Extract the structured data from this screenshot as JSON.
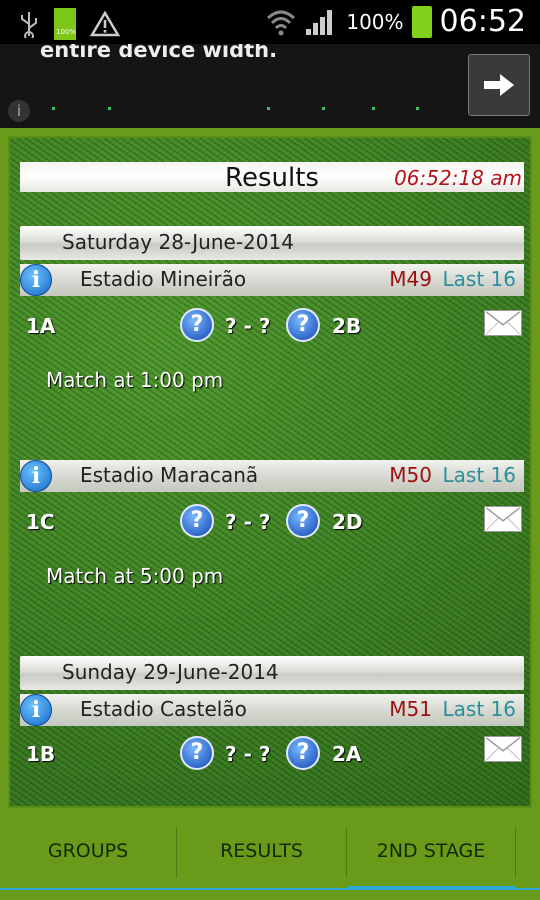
{
  "status_bar": {
    "battery_small_label": "100%",
    "battery_percent": "100%",
    "time": "06:52",
    "icons": [
      "usb-icon",
      "battery-icon",
      "warning-icon",
      "wifi-icon",
      "signal-icon",
      "battery-icon"
    ]
  },
  "ad": {
    "text": "entire device width.",
    "info_glyph": "i",
    "arrow_glyph": "→"
  },
  "header": {
    "title": "Results",
    "clock": "06:52:18 am"
  },
  "days": [
    {
      "label": "Saturday 28-June-2014"
    },
    {
      "label": "Sunday 29-June-2014"
    }
  ],
  "matches": [
    {
      "venue": "Estadio Mineirão",
      "code": "M49",
      "round": "Last 16",
      "home": "1A",
      "away": "2B",
      "score": "? - ?",
      "time": "Match at 1:00 pm"
    },
    {
      "venue": "Estadio Maracanã",
      "code": "M50",
      "round": "Last 16",
      "home": "1C",
      "away": "2D",
      "score": "? - ?",
      "time": "Match at 5:00 pm"
    },
    {
      "venue": "Estadio Castelão",
      "code": "M51",
      "round": "Last 16",
      "home": "1B",
      "away": "2A",
      "score": "? - ?"
    }
  ],
  "tabs": [
    {
      "label": "GROUPS",
      "active": false
    },
    {
      "label": "RESULTS",
      "active": false
    },
    {
      "label": "2ND STAGE",
      "active": true
    }
  ],
  "colors": {
    "accent": "#2aa8d8",
    "clock": "#b3141a",
    "match_code": "#9b1010",
    "round": "#2a8f9c",
    "background": "#6a9a1a"
  }
}
